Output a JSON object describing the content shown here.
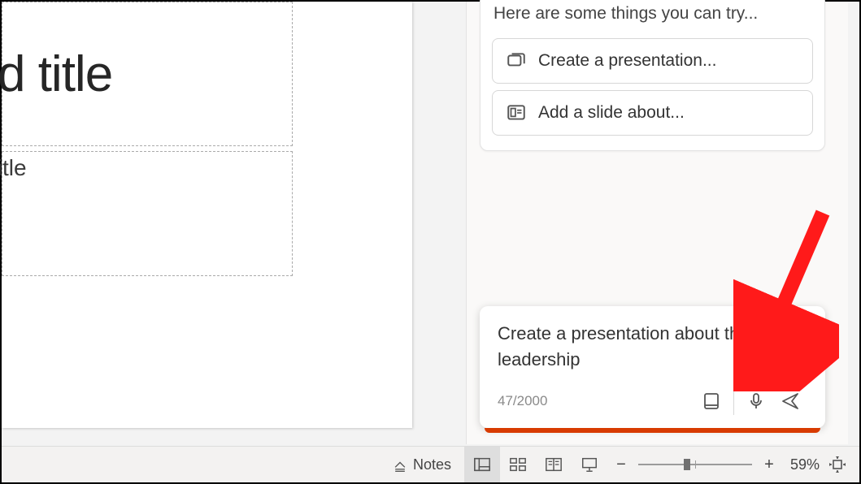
{
  "slide": {
    "title_fragment": "d title",
    "subtitle_fragment": "title"
  },
  "copilot": {
    "header": "Here are some things you can try...",
    "suggestions": [
      {
        "label": "Create a presentation..."
      },
      {
        "label": "Add a slide about..."
      }
    ],
    "prompt_text": "Create a presentation about thought leadership",
    "counter": "47/2000"
  },
  "status": {
    "notes_label": "Notes",
    "zoom_label": "59%"
  }
}
